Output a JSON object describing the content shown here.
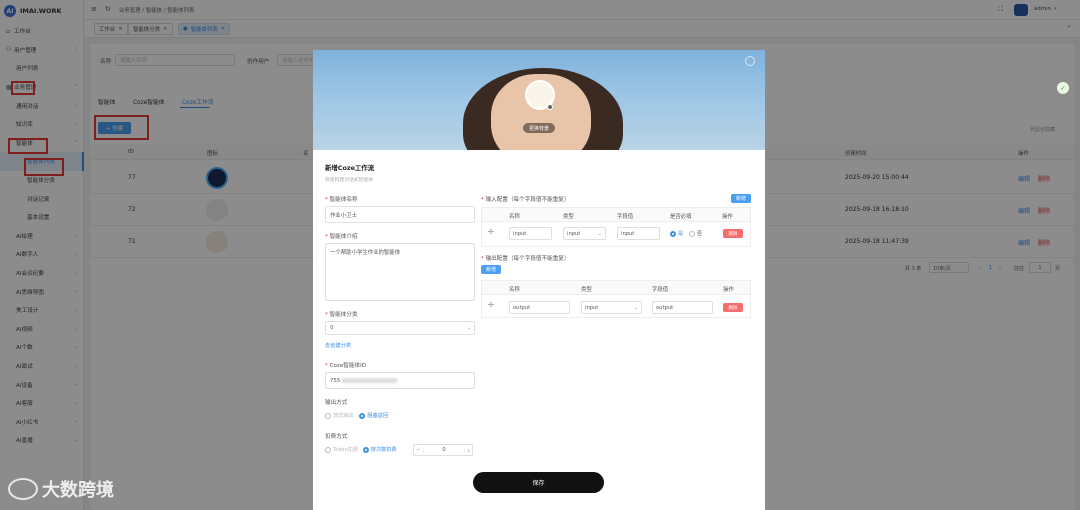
{
  "app": {
    "name": "IMAI.WORK",
    "logo_text": "AI"
  },
  "sidebar": {
    "items": [
      {
        "label": "工作台",
        "icon": "home-icon",
        "type": "top"
      },
      {
        "label": "用户管理",
        "icon": "user-icon",
        "type": "top",
        "expand": "up"
      },
      {
        "label": "用户列表",
        "type": "sub"
      },
      {
        "label": "业务管理",
        "type": "top",
        "expand": "up"
      },
      {
        "label": "通用对话",
        "type": "sub",
        "expand": "down"
      },
      {
        "label": "知识库",
        "type": "sub",
        "expand": "down"
      },
      {
        "label": "智能体",
        "type": "sub",
        "expand": "up"
      },
      {
        "label": "智能体列表",
        "type": "sub2",
        "active": true
      },
      {
        "label": "智能体分类",
        "type": "sub2"
      },
      {
        "label": "对话记录",
        "type": "sub2"
      },
      {
        "label": "基本设置",
        "type": "sub2"
      },
      {
        "label": "AI绘理",
        "type": "sub",
        "expand": "down"
      },
      {
        "label": "AI数字人",
        "type": "sub",
        "expand": "down"
      },
      {
        "label": "AI会议纪要",
        "type": "sub",
        "expand": "down"
      },
      {
        "label": "AI思维导图",
        "type": "sub",
        "expand": "down"
      },
      {
        "label": "美工设计",
        "type": "sub",
        "expand": "down"
      },
      {
        "label": "AI视频",
        "type": "sub",
        "expand": "down"
      },
      {
        "label": "AI个数",
        "type": "sub",
        "expand": "down"
      },
      {
        "label": "AI面试",
        "type": "sub",
        "expand": "down"
      },
      {
        "label": "AI设备",
        "type": "sub",
        "expand": "down"
      },
      {
        "label": "AI客服",
        "type": "sub",
        "expand": "down"
      },
      {
        "label": "AI小红书",
        "type": "sub",
        "expand": "down"
      },
      {
        "label": "AI直播",
        "type": "sub",
        "expand": "down"
      }
    ]
  },
  "topbar": {
    "breadcrumb": [
      "业务管理",
      "智能体",
      "智能体列表"
    ],
    "user": "admin"
  },
  "tabs": [
    {
      "label": "工作台",
      "active": false
    },
    {
      "label": "智能体分类",
      "active": false
    },
    {
      "label": "智能体列表",
      "active": true
    }
  ],
  "page": {
    "filter_name_label": "名称",
    "filter_name_placeholder": "请输入名称",
    "filter_creator_label": "创作用户",
    "filter_creator_placeholder": "请输入创作用户",
    "subtabs": [
      "智能体",
      "Coze智能体",
      "Coze工作流"
    ],
    "create_button": "+ 创建",
    "column_settings": "列显示隐藏",
    "columns": [
      "ID",
      "图标",
      "名",
      "创建时间",
      "操作"
    ],
    "rows": [
      {
        "id": "77",
        "created": "2025-09-20 15:00:44",
        "edit": "编辑",
        "delete": "删除"
      },
      {
        "id": "72",
        "created": "2025-09-18 16:18:10",
        "edit": "编辑",
        "delete": "删除"
      },
      {
        "id": "71",
        "created": "2025-09-18 11:47:39",
        "edit": "编辑",
        "delete": "删除"
      }
    ],
    "pagination": {
      "total": "共 3 条",
      "page_size": "10条/页",
      "current": "1",
      "goto_label": "前往",
      "goto_value": "1",
      "page_unit": "页"
    }
  },
  "modal": {
    "change_bg": "更换背景",
    "title": "新增Coze工作流",
    "subtitle": "快速构建对话式智能体",
    "name_label": "智能体名称",
    "name_value": "作业小卫士",
    "intro_label": "智能体介绍",
    "intro_value": "一个帮助小学生作业的智能体",
    "category_label": "智能体分类",
    "category_value": "0",
    "create_category_link": "去创建分类",
    "coze_id_label": "Coze智能体ID",
    "coze_id_value": "755",
    "output_mode_label": "输出方式",
    "output_mode_options": [
      "流式输出",
      "阻塞返回"
    ],
    "output_mode_selected": 1,
    "billing_label": "扣费方式",
    "billing_options": [
      "Token扣费",
      "按次数扣费"
    ],
    "billing_selected": 1,
    "billing_value": "0",
    "input_config_label": "输入配置（每个字段值不能重复）",
    "input_add": "新增",
    "input_columns": [
      "名称",
      "类型",
      "字段值",
      "是否必填",
      "操作"
    ],
    "input_row": {
      "name": "input",
      "type": "input",
      "field": "input",
      "required_yes": "是",
      "required_no": "否",
      "delete": "删除"
    },
    "output_config_label": "输出配置（每个字段值不能重复）",
    "output_add": "新增",
    "output_columns": [
      "名称",
      "类型",
      "字段值",
      "操作"
    ],
    "output_row": {
      "name": "output",
      "type": "input",
      "field": "output",
      "delete": "删除"
    },
    "save": "保存"
  },
  "watermark": "大数跨境"
}
